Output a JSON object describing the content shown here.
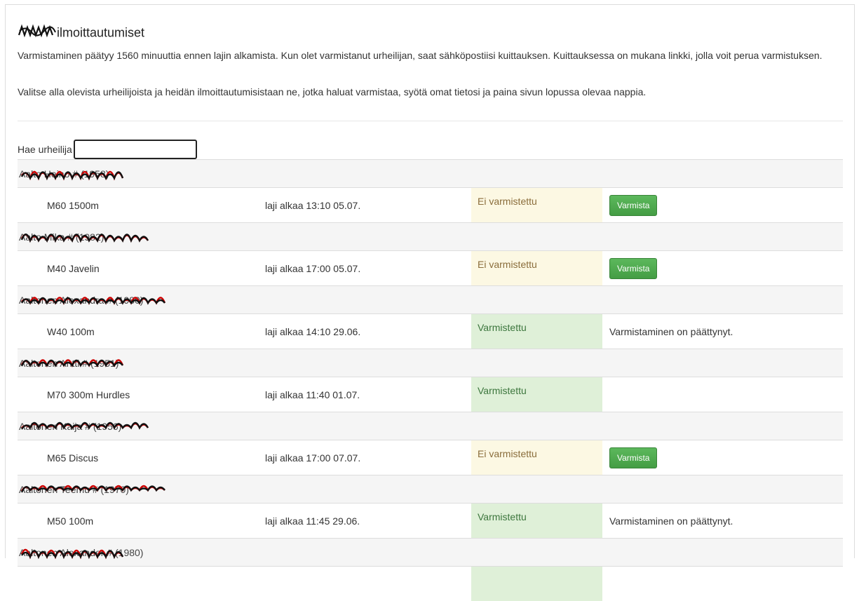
{
  "header": {
    "title_redacted": "Aivan",
    "title_suffix": "ilmoittautumiset",
    "paragraph1": "Varmistaminen päätyy 1560 minuuttia ennen lajin alkamista. Kun olet varmistanut urheilijan, saat sähköpostiisi kuittauksen. Kuittauksessa on mukana linkki, jolla voit perua varmistuksen.",
    "paragraph2": "Valitse alla olevista urheilijoista ja heidän ilmoittautumisistaan ne, jotka haluat varmistaa, syötä omat tietosi ja paina sivun lopussa olevaa nappia."
  },
  "search": {
    "label": "Hae urheilija",
    "value": "",
    "placeholder": ""
  },
  "athletes": [
    {
      "name": "Aalto Heino # (1958)",
      "events": [
        {
          "event": "M60 1500m",
          "time": "laji alkaa 13:10 05.07.",
          "status": "Ei varmistettu",
          "state": "pending",
          "action": "Varmista",
          "note": ""
        }
      ]
    },
    {
      "name": "Aalto Mika # (1982)",
      "events": [
        {
          "event": "M40 Javelin",
          "time": "laji alkaa 17:00 05.07.",
          "status": "Ei varmistettu",
          "state": "pending",
          "action": "Varmista",
          "note": ""
        }
      ]
    },
    {
      "name": "Aaltonen Alexandra # (1980)",
      "events": [
        {
          "event": "W40 100m",
          "time": "laji alkaa 14:10 29.06.",
          "status": "Varmistettu",
          "state": "done",
          "action": "",
          "note": "Varmistaminen on päättynyt."
        }
      ]
    },
    {
      "name": "Aaltonen Antti # (1951)",
      "events": [
        {
          "event": "M70 300m Hurdles",
          "time": "laji alkaa 11:40 01.07.",
          "status": "Varmistettu",
          "state": "done",
          "action": "",
          "note": ""
        }
      ]
    },
    {
      "name": "Aaltonen Kaija # (1956)",
      "events": [
        {
          "event": "M65 Discus",
          "time": "laji alkaa 17:00 07.07.",
          "status": "Ei varmistettu",
          "state": "pending",
          "action": "Varmista",
          "note": ""
        }
      ]
    },
    {
      "name": "Aaltonen Teemu # (1970)",
      "events": [
        {
          "event": "M50 100m",
          "time": "laji alkaa 11:45 29.06.",
          "status": "Varmistettu",
          "state": "done",
          "action": "",
          "note": "Varmistaminen on päättynyt."
        }
      ]
    },
    {
      "name": "Aaltonen Alexander # (1980)",
      "events": [
        {
          "event": "",
          "time": "",
          "status": "",
          "state": "done",
          "action": "",
          "note": ""
        }
      ]
    }
  ],
  "colors": {
    "pending_bg": "#fcf8e3",
    "pending_text": "#8a6d3b",
    "done_bg": "#dff0d8",
    "done_text": "#3c763d",
    "button": "#449d44",
    "name_row_bg": "#f5f5f5"
  }
}
